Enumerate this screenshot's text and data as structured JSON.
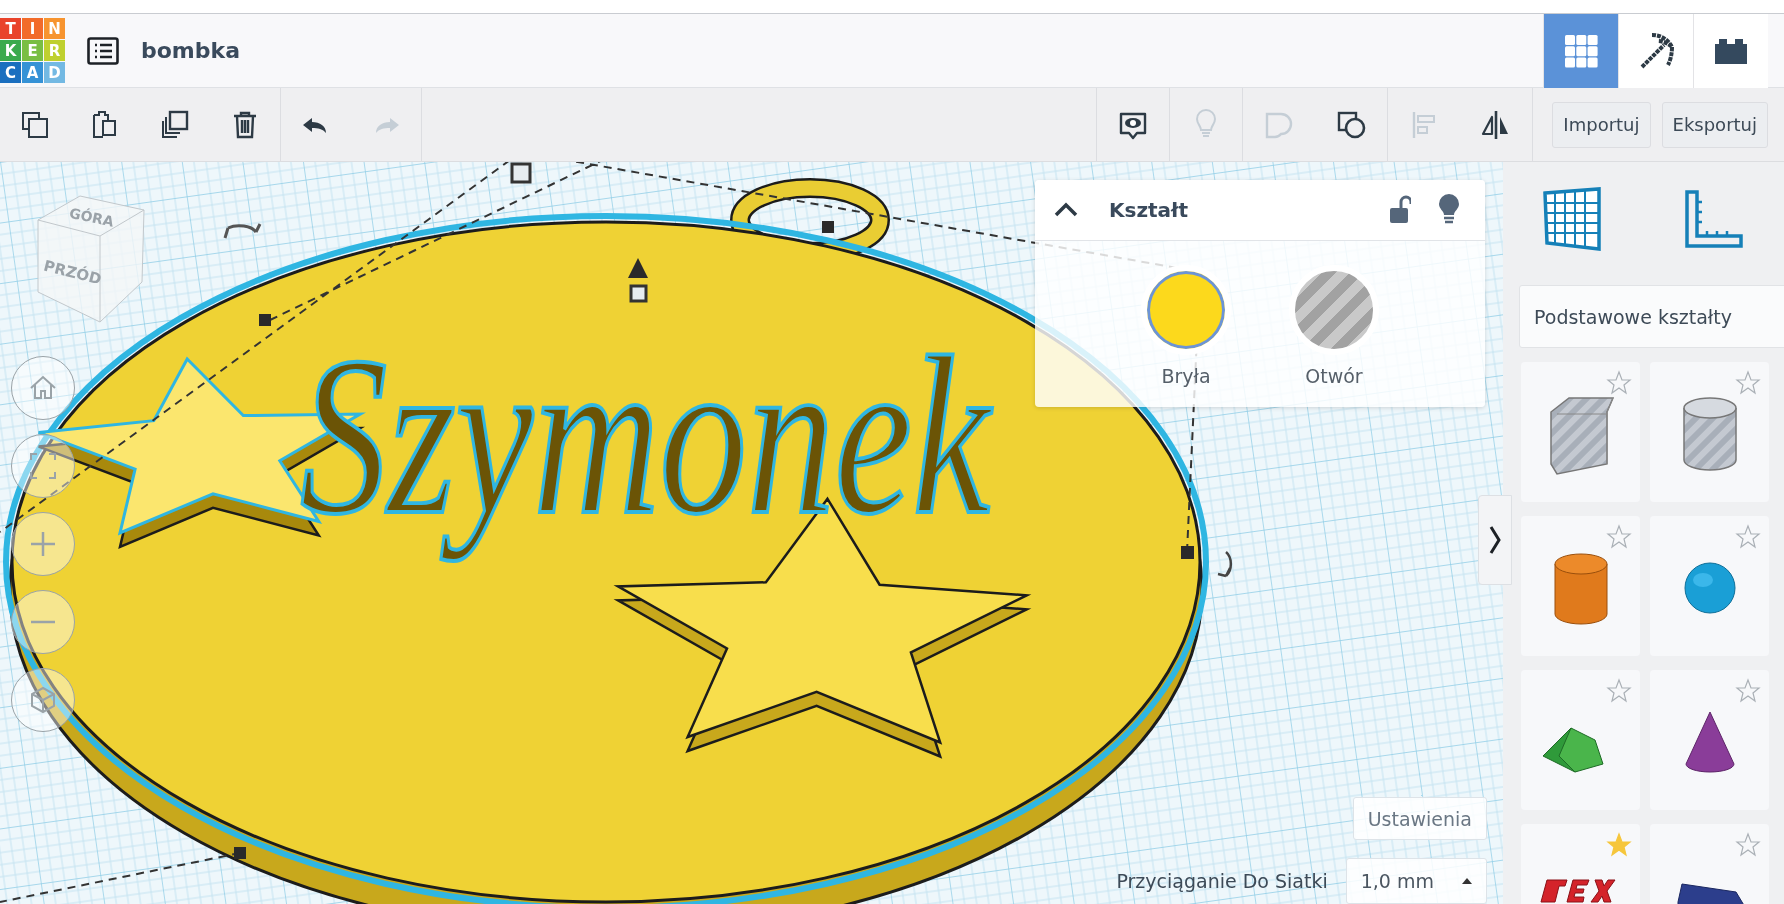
{
  "logo": {
    "letters": [
      {
        "char": "T",
        "color": "#e9432b"
      },
      {
        "char": "I",
        "color": "#f26b2a"
      },
      {
        "char": "N",
        "color": "#f7942f"
      },
      {
        "char": "K",
        "color": "#3aaa4c"
      },
      {
        "char": "E",
        "color": "#79be43"
      },
      {
        "char": "R",
        "color": "#bfd02f"
      },
      {
        "char": "C",
        "color": "#1a6fbf"
      },
      {
        "char": "A",
        "color": "#3592d6"
      },
      {
        "char": "D",
        "color": "#73b9e3"
      }
    ]
  },
  "header": {
    "title": "bombka",
    "modes": [
      {
        "kind": "design",
        "selected": true
      },
      {
        "kind": "blocks",
        "selected": false
      },
      {
        "kind": "bricks",
        "selected": false
      }
    ]
  },
  "toolbar": {
    "left_groups": [
      [
        {
          "kind": "copy",
          "disabled": false
        },
        {
          "kind": "paste",
          "disabled": false
        },
        {
          "kind": "duplicate",
          "disabled": false
        },
        {
          "kind": "delete",
          "disabled": false
        }
      ],
      [
        {
          "kind": "undo",
          "disabled": false
        },
        {
          "kind": "redo",
          "disabled": true
        }
      ]
    ],
    "right_groups": [
      [
        {
          "kind": "notes",
          "disabled": false
        }
      ],
      [
        {
          "kind": "light",
          "disabled": true
        }
      ],
      [
        {
          "kind": "group",
          "disabled": true
        },
        {
          "kind": "ungroup",
          "disabled": false
        }
      ],
      [
        {
          "kind": "align",
          "disabled": true
        },
        {
          "kind": "mirror",
          "disabled": false
        }
      ]
    ],
    "buttons": [
      "Importuj",
      "Eksportuj"
    ]
  },
  "viewport": {
    "view_cube": [
      "GÓRA",
      "PRZÓD"
    ],
    "model_text": "Szymonek",
    "view_controls": [
      {
        "kind": "home"
      },
      {
        "kind": "fit"
      },
      {
        "kind": "zoom-in"
      },
      {
        "kind": "zoom-out"
      },
      {
        "kind": "ortho"
      }
    ],
    "settings_button": "Ustawienia",
    "snap": {
      "label": "Przyciąganie Do Siatki",
      "value": "1,0 mm"
    }
  },
  "shape_panel": {
    "title": "Kształt",
    "expanded": true,
    "locked": false,
    "options": [
      {
        "label": "Bryła",
        "kind": "solid",
        "selected": true
      },
      {
        "label": "Otwór",
        "kind": "hole",
        "selected": false
      }
    ]
  },
  "shapes": {
    "category": "Podstawowe kształty",
    "items": [
      {
        "kind": "box-hole",
        "favorite": false
      },
      {
        "kind": "cylinder-hole",
        "favorite": false
      },
      {
        "kind": "cylinder",
        "favorite": false
      },
      {
        "kind": "sphere",
        "favorite": false
      },
      {
        "kind": "roof",
        "favorite": false
      },
      {
        "kind": "cone",
        "favorite": false
      },
      {
        "kind": "text",
        "favorite": true
      },
      {
        "kind": "wedge",
        "favorite": false
      }
    ]
  }
}
